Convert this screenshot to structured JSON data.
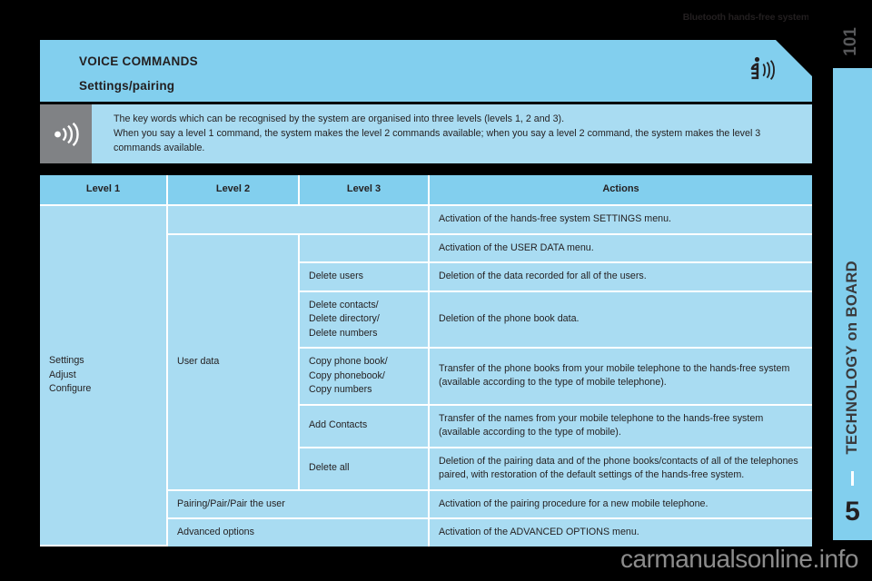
{
  "running_head": {
    "text": "Bluetooth hands-free system",
    "bar_color": "#2e9bd6"
  },
  "side_rail": {
    "page_number": "101",
    "section_title": "TECHNOLOGY on BOARD",
    "chapter_number": "5",
    "tab_color": "#82cfee"
  },
  "banner": {
    "title": "VOICE COMMANDS",
    "subtitle": "Settings/pairing",
    "icon": "voice-command-icon",
    "color": "#82cfee"
  },
  "note": {
    "icon": "sound-waves-icon",
    "icon_box_color": "#808285",
    "line1": "The key words which can be recognised by the system are organised into three levels (levels 1, 2 and 3).",
    "line2": "When you say a level 1 command, the system makes the level 2 commands available; when you say a level 2 command, the system makes the level 3 commands available."
  },
  "table": {
    "header_color": "#82cfee",
    "cell_color": "#a9dcf2",
    "headers": [
      "Level 1",
      "Level 2",
      "Level 3",
      "Actions"
    ],
    "level1": {
      "lines": [
        "Settings",
        "Adjust",
        "Configure"
      ]
    },
    "rows": [
      {
        "level2": "",
        "level3": "",
        "action": "Activation of the hands-free system SETTINGS menu."
      },
      {
        "level2": "User data",
        "level3": "",
        "action": "Activation of the USER DATA menu."
      },
      {
        "level2": "",
        "level3": "Delete users",
        "action": "Deletion of the data recorded for all of the users."
      },
      {
        "level2": "",
        "level3_lines": [
          "Delete contacts/",
          "Delete directory/",
          "Delete numbers"
        ],
        "action": "Deletion of the phone book data."
      },
      {
        "level2": "",
        "level3_lines": [
          "Copy phone book/",
          "Copy phonebook/",
          "Copy numbers"
        ],
        "action": "Transfer of the phone books from your mobile telephone to the hands-free system (available according to the type of mobile telephone)."
      },
      {
        "level2": "",
        "level3": "Add Contacts",
        "action": "Transfer of the names from your mobile telephone to the hands-free system (available according to the type of mobile)."
      },
      {
        "level2": "",
        "level3": "Delete all",
        "action": "Deletion of the pairing data and of the phone books/contacts of all of the telephones paired, with restoration of the default settings of the hands-free system."
      },
      {
        "level2": "Pairing/Pair/Pair the user",
        "level3": "",
        "action": "Activation of the pairing procedure for a new mobile telephone."
      },
      {
        "level2": "Advanced options",
        "level3": "",
        "action": "Activation of the ADVANCED OPTIONS menu."
      }
    ]
  },
  "watermark": {
    "text": "carmanualsonline.info"
  }
}
